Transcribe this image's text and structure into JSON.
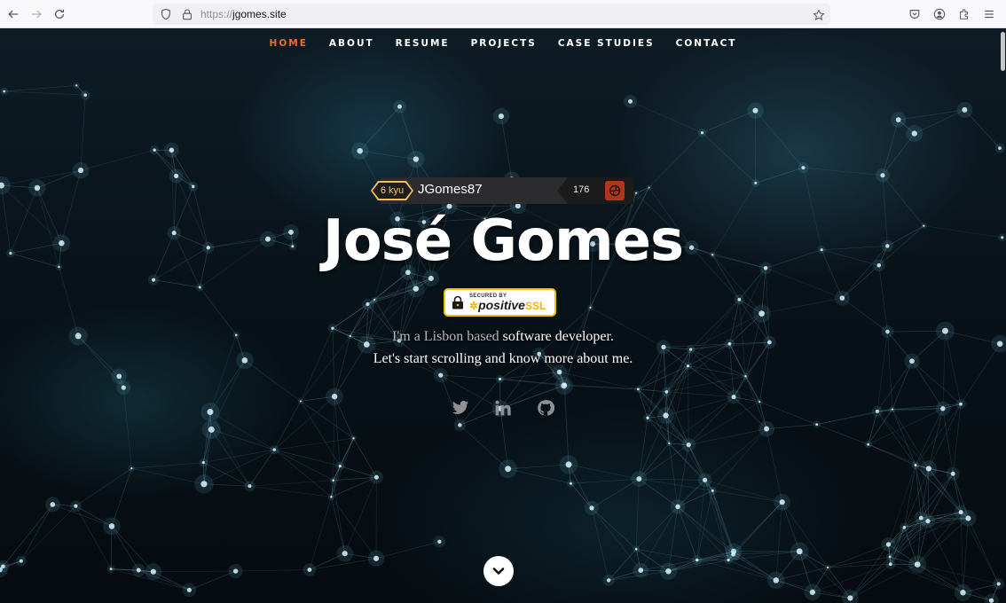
{
  "browser": {
    "url_scheme": "https://",
    "url_host": "jgomes.site"
  },
  "nav": {
    "items": [
      {
        "label": "HOME",
        "active": true
      },
      {
        "label": "ABOUT",
        "active": false
      },
      {
        "label": "RESUME",
        "active": false
      },
      {
        "label": "PROJECTS",
        "active": false
      },
      {
        "label": "CASE STUDIES",
        "active": false
      },
      {
        "label": "CONTACT",
        "active": false
      }
    ],
    "active_color": "#f06b2c"
  },
  "codewars": {
    "rank": "6 kyu",
    "username": "JGomes87",
    "honor": "176"
  },
  "hero": {
    "title": "José Gomes",
    "ssl_secured": "SECURED BY",
    "ssl_brand": "positive",
    "ssl_brand_suffix": "SSL",
    "intro_muted": "I'm a Lisbon based",
    "intro_highlight": "software developer.",
    "intro_line2": "Let's start scrolling and know more about me."
  },
  "social": [
    "twitter-icon",
    "linkedin-icon",
    "github-icon"
  ]
}
